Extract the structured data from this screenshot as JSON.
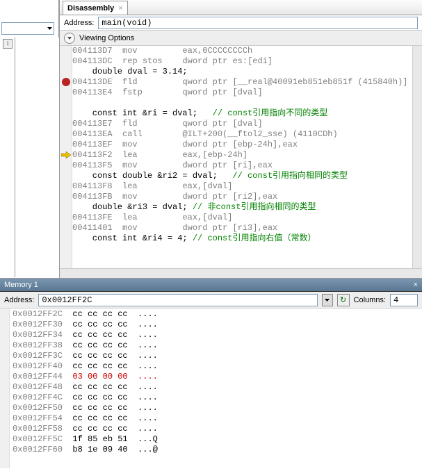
{
  "disasm": {
    "tab_label": "Disassembly",
    "addr_label": "Address:",
    "addr_value": "main(void)",
    "viewing_options": "Viewing Options",
    "lines": [
      {
        "t": "asm",
        "addr": "004113D7",
        "mnem": "mov",
        "oper": "eax,0CCCCCCCCh"
      },
      {
        "t": "asm",
        "addr": "004113DC",
        "mnem": "rep stos",
        "oper": "dword ptr es:[edi]"
      },
      {
        "t": "src",
        "text": "    double dval = 3.14;"
      },
      {
        "t": "asm",
        "addr": "004113DE",
        "mnem": "fld",
        "oper": "qword ptr [__real@40091eb851eb851f (415840h)]",
        "bp": true
      },
      {
        "t": "asm",
        "addr": "004113E4",
        "mnem": "fstp",
        "oper": "qword ptr [dval]"
      },
      {
        "t": "blank"
      },
      {
        "t": "src",
        "text": "    const int &ri = dval;",
        "cmt": "   // const引用指向不同的类型"
      },
      {
        "t": "asm",
        "addr": "004113E7",
        "mnem": "fld",
        "oper": "qword ptr [dval]"
      },
      {
        "t": "asm",
        "addr": "004113EA",
        "mnem": "call",
        "oper": "@ILT+200(__ftol2_sse) (4110CDh)"
      },
      {
        "t": "asm",
        "addr": "004113EF",
        "mnem": "mov",
        "oper": "dword ptr [ebp-24h],eax"
      },
      {
        "t": "asm",
        "addr": "004113F2",
        "mnem": "lea",
        "oper": "eax,[ebp-24h]",
        "cur": true
      },
      {
        "t": "asm",
        "addr": "004113F5",
        "mnem": "mov",
        "oper": "dword ptr [ri],eax"
      },
      {
        "t": "src",
        "text": "    const double &ri2 = dval;",
        "cmt": "   // const引用指向相同的类型"
      },
      {
        "t": "asm",
        "addr": "004113F8",
        "mnem": "lea",
        "oper": "eax,[dval]"
      },
      {
        "t": "asm",
        "addr": "004113FB",
        "mnem": "mov",
        "oper": "dword ptr [ri2],eax"
      },
      {
        "t": "src",
        "text": "    double &ri3 = dval;",
        "cmt": " // 非const引用指向相同的类型"
      },
      {
        "t": "asm",
        "addr": "004113FE",
        "mnem": "lea",
        "oper": "eax,[dval]"
      },
      {
        "t": "asm",
        "addr": "00411401",
        "mnem": "mov",
        "oper": "dword ptr [ri3],eax"
      },
      {
        "t": "src",
        "text": "    const int &ri4 = 4;",
        "cmt": " // const引用指向右值（常数）"
      }
    ]
  },
  "memory": {
    "title": "Memory 1",
    "addr_label": "Address:",
    "addr_value": "0x0012FF2C",
    "cols_label": "Columns:",
    "cols_value": "4",
    "rows": [
      {
        "addr": "0x0012FF2C",
        "hex": "cc cc cc cc",
        "asc": "...."
      },
      {
        "addr": "0x0012FF30",
        "hex": "cc cc cc cc",
        "asc": "...."
      },
      {
        "addr": "0x0012FF34",
        "hex": "cc cc cc cc",
        "asc": "...."
      },
      {
        "addr": "0x0012FF38",
        "hex": "cc cc cc cc",
        "asc": "...."
      },
      {
        "addr": "0x0012FF3C",
        "hex": "cc cc cc cc",
        "asc": "...."
      },
      {
        "addr": "0x0012FF40",
        "hex": "cc cc cc cc",
        "asc": "...."
      },
      {
        "addr": "0x0012FF44",
        "hex": "03 00 00 00",
        "asc": "....",
        "red": true
      },
      {
        "addr": "0x0012FF48",
        "hex": "cc cc cc cc",
        "asc": "...."
      },
      {
        "addr": "0x0012FF4C",
        "hex": "cc cc cc cc",
        "asc": "...."
      },
      {
        "addr": "0x0012FF50",
        "hex": "cc cc cc cc",
        "asc": "...."
      },
      {
        "addr": "0x0012FF54",
        "hex": "cc cc cc cc",
        "asc": "...."
      },
      {
        "addr": "0x0012FF58",
        "hex": "cc cc cc cc",
        "asc": "...."
      },
      {
        "addr": "0x0012FF5C",
        "hex": "1f 85 eb 51",
        "asc": "...Q"
      },
      {
        "addr": "0x0012FF60",
        "hex": "b8 1e 09 40",
        "asc": "...@"
      }
    ]
  }
}
